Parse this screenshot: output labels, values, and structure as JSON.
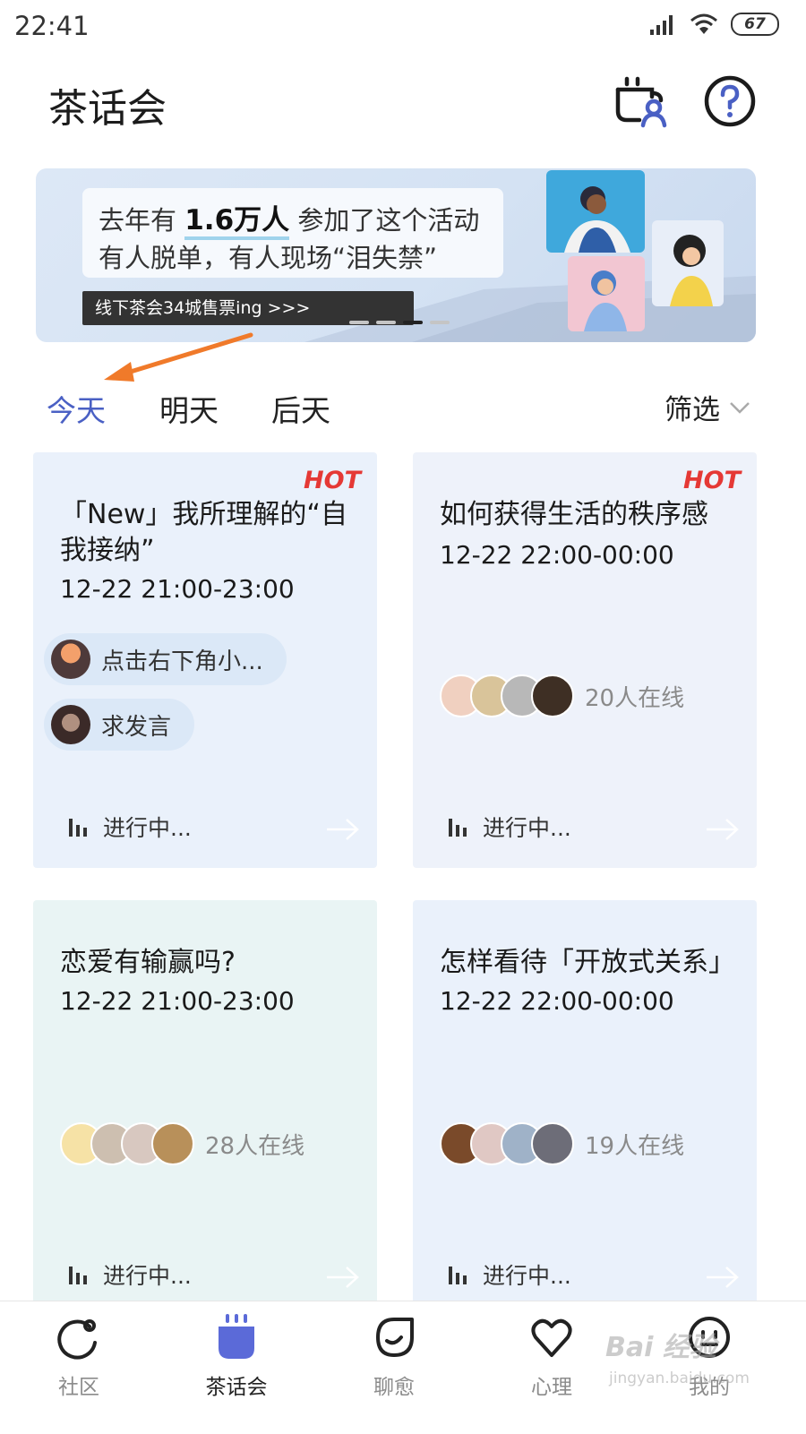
{
  "status_bar": {
    "time": "22:41",
    "battery": "67"
  },
  "header": {
    "title": "茶话会",
    "cup_icon": "tea-cup-user-icon",
    "help_icon": "question-icon"
  },
  "banner": {
    "line1_prefix": "去年有 ",
    "line1_highlight": "1.6万人",
    "line1_suffix": " 参加了这个活动",
    "line2": "有人脱单，有人现场“泪失禁”",
    "ticket": "线下茶会34城售票ing >>>",
    "page_count": 4,
    "active_page": 3
  },
  "tabs": [
    {
      "label": "今天",
      "active": true
    },
    {
      "label": "明天",
      "active": false
    },
    {
      "label": "后天",
      "active": false
    }
  ],
  "filter": {
    "label": "筛选"
  },
  "cards": [
    {
      "hot": "HOT",
      "title": "「New」我所理解的“自我接纳”",
      "time": "12-22 21:00-23:00",
      "chips": [
        {
          "text": "点击右下角小..."
        },
        {
          "text": "求发言"
        }
      ],
      "status": "进行中..."
    },
    {
      "hot": "HOT",
      "title": "如何获得生活的秩序感",
      "time": "12-22 22:00-00:00",
      "online": "20人在线",
      "status": "进行中..."
    },
    {
      "title": "恋爱有输赢吗?",
      "time": "12-22 21:00-23:00",
      "online": "28人在线",
      "status": "进行中..."
    },
    {
      "title": "怎样看待「开放式关系」",
      "time": "12-22 22:00-00:00",
      "online": "19人在线",
      "status": "进行中..."
    }
  ],
  "bottom_nav": [
    {
      "label": "社区",
      "icon": "community-icon",
      "active": false
    },
    {
      "label": "茶话会",
      "icon": "tea-party-icon",
      "active": true
    },
    {
      "label": "聊愈",
      "icon": "chat-heal-icon",
      "active": false
    },
    {
      "label": "心理",
      "icon": "heart-icon",
      "active": false
    },
    {
      "label": "我的",
      "icon": "profile-face-icon",
      "active": false
    }
  ],
  "watermark": {
    "text": "Bai 经验",
    "sub": "jingyan.baidu.com"
  },
  "colors": {
    "accent": "#4a60c4",
    "hot": "#e53935",
    "nav_active": "#5b6ad8"
  }
}
